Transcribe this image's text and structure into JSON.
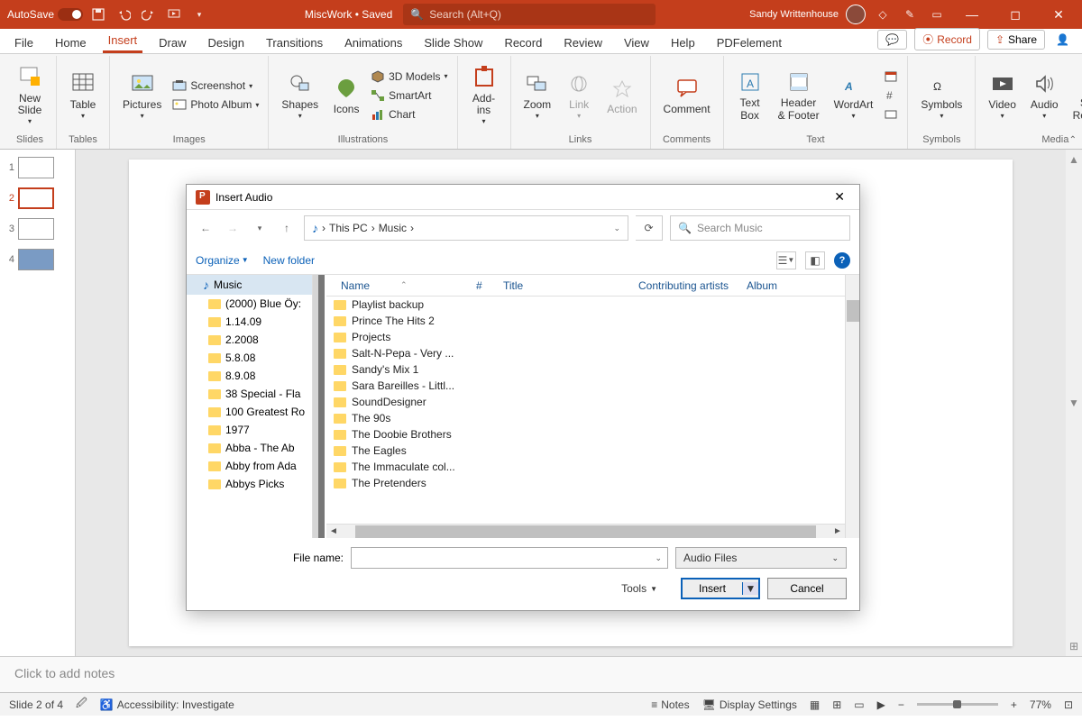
{
  "titlebar": {
    "autosave": "AutoSave",
    "autosave_state": "On",
    "doc": "MiscWork • Saved",
    "search_placeholder": "Search (Alt+Q)",
    "user": "Sandy Writtenhouse"
  },
  "tabs": {
    "items": [
      "File",
      "Home",
      "Insert",
      "Draw",
      "Design",
      "Transitions",
      "Animations",
      "Slide Show",
      "Record",
      "Review",
      "View",
      "Help",
      "PDFelement"
    ],
    "active": 2,
    "record": "Record",
    "share": "Share"
  },
  "ribbon": {
    "groups": {
      "slides": {
        "label": "Slides",
        "new_slide": "New\nSlide"
      },
      "tables": {
        "label": "Tables",
        "table": "Table"
      },
      "images": {
        "label": "Images",
        "pictures": "Pictures",
        "screenshot": "Screenshot",
        "photo_album": "Photo Album"
      },
      "illustrations": {
        "label": "Illustrations",
        "shapes": "Shapes",
        "icons": "Icons",
        "models": "3D Models",
        "smartart": "SmartArt",
        "chart": "Chart"
      },
      "addins": {
        "add_ins": "Add-\nins"
      },
      "links": {
        "label": "Links",
        "zoom": "Zoom",
        "link": "Link",
        "action": "Action"
      },
      "comments": {
        "label": "Comments",
        "comment": "Comment"
      },
      "text": {
        "label": "Text",
        "text_box": "Text\nBox",
        "header_footer": "Header\n& Footer",
        "wordart": "WordArt"
      },
      "symbols": {
        "label": "Symbols",
        "symbols": "Symbols"
      },
      "media": {
        "label": "Media",
        "video": "Video",
        "audio": "Audio",
        "screen_recording": "Screen\nRecording"
      }
    }
  },
  "slides": [
    {
      "num": "1"
    },
    {
      "num": "2"
    },
    {
      "num": "3"
    },
    {
      "num": "4"
    }
  ],
  "notes_placeholder": "Click to add notes",
  "statusbar": {
    "slide": "Slide 2 of 4",
    "accessibility": "Accessibility: Investigate",
    "notes": "Notes",
    "display": "Display Settings",
    "zoom": "77%"
  },
  "dialog": {
    "title": "Insert Audio",
    "breadcrumb": [
      "This PC",
      "Music"
    ],
    "search_placeholder": "Search Music",
    "organize": "Organize",
    "new_folder": "New folder",
    "tree": [
      "Music",
      "(2000) Blue Öy:",
      "1.14.09",
      "2.2008",
      "5.8.08",
      "8.9.08",
      "38 Special - Fla",
      "100 Greatest Ro",
      "1977",
      "Abba - The Ab",
      "Abby from Ada",
      "Abbys Picks"
    ],
    "columns": {
      "name": "Name",
      "num": "#",
      "title": "Title",
      "artists": "Contributing artists",
      "album": "Album"
    },
    "files": [
      "Playlist backup",
      "Prince The Hits 2",
      "Projects",
      "Salt-N-Pepa - Very ...",
      "Sandy's Mix 1",
      "Sara Bareilles - Littl...",
      "SoundDesigner",
      "The 90s",
      "The Doobie Brothers",
      "The Eagles",
      "The Immaculate col...",
      "The Pretenders"
    ],
    "file_name_label": "File name:",
    "filter": "Audio Files",
    "tools": "Tools",
    "insert": "Insert",
    "cancel": "Cancel"
  }
}
